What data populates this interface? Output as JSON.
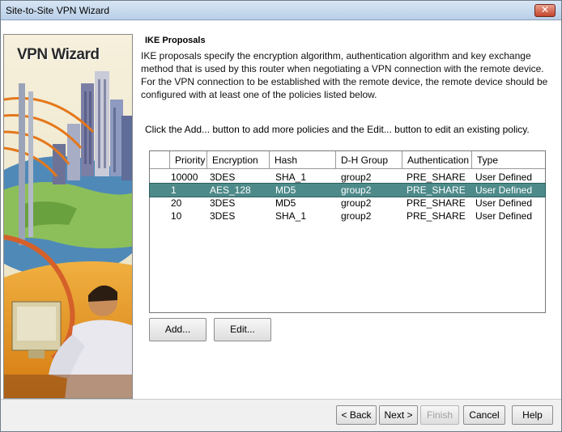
{
  "window": {
    "title": "Site-to-Site VPN Wizard",
    "close_label": "✕"
  },
  "sidebar": {
    "title": "VPN Wizard"
  },
  "main": {
    "heading": "IKE Proposals",
    "description": "IKE proposals specify the encryption algorithm, authentication algorithm and key exchange method that is used by this router when negotiating a VPN connection with the remote device. For the VPN connection to be established with the remote device, the remote device should be configured with at least one of the policies listed below.",
    "hint": "Click the Add... button to add more policies and the Edit... button to edit an existing policy."
  },
  "table": {
    "headers": [
      "",
      "Priority",
      "Encryption",
      "Hash",
      "D-H Group",
      "Authentication",
      "Type"
    ],
    "rows": [
      {
        "priority": "10000",
        "encryption": "3DES",
        "hash": "SHA_1",
        "dh": "group2",
        "auth": "PRE_SHARE",
        "type": "User Defined"
      },
      {
        "priority": "1",
        "encryption": "AES_128",
        "hash": "MD5",
        "dh": "group2",
        "auth": "PRE_SHARE",
        "type": "User Defined"
      },
      {
        "priority": "20",
        "encryption": "3DES",
        "hash": "MD5",
        "dh": "group2",
        "auth": "PRE_SHARE",
        "type": "User Defined"
      },
      {
        "priority": "10",
        "encryption": "3DES",
        "hash": "SHA_1",
        "dh": "group2",
        "auth": "PRE_SHARE",
        "type": "User Defined"
      }
    ],
    "selected_row": 1
  },
  "actions": {
    "add": "Add...",
    "edit": "Edit..."
  },
  "footer": {
    "back": "< Back",
    "next": "Next >",
    "finish": "Finish",
    "cancel": "Cancel",
    "help": "Help"
  },
  "colors": {
    "selection": "#4e8a8a",
    "title_gradient": "#b9cfe7"
  }
}
